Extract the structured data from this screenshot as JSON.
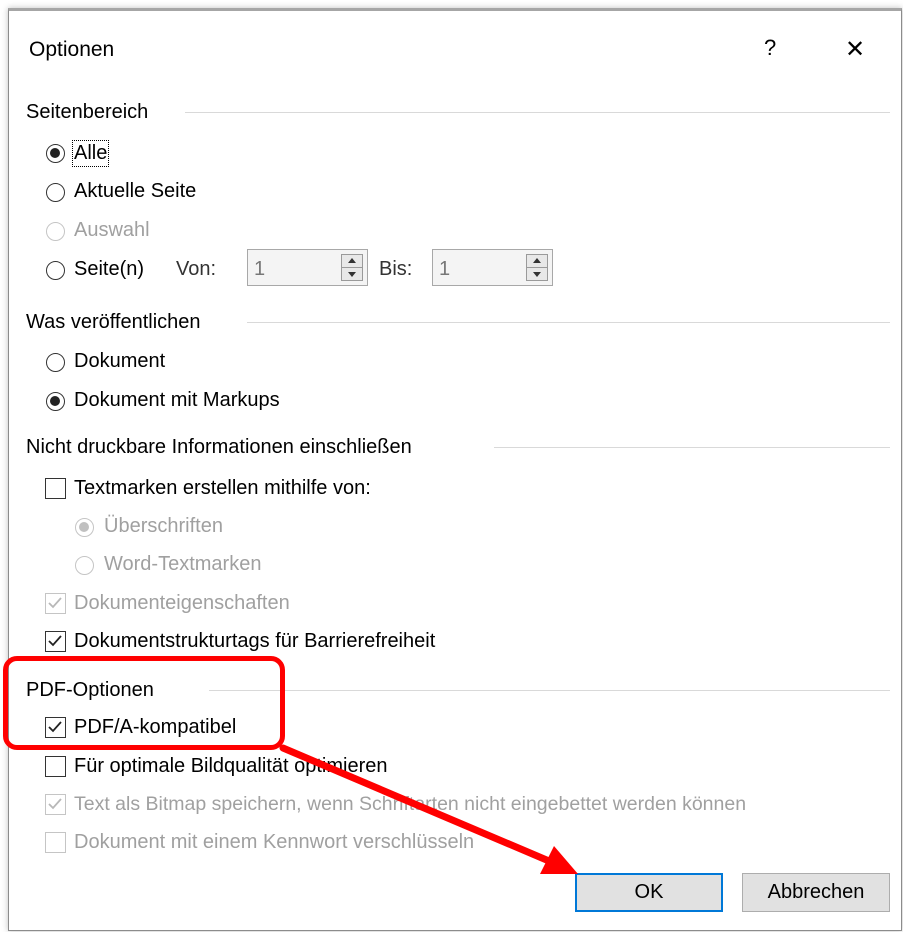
{
  "dialog": {
    "title": "Optionen",
    "help_label": "?",
    "close_label": "✕"
  },
  "seitenbereich": {
    "heading": "Seitenbereich",
    "alle": "Alle",
    "aktuelle_seite": "Aktuelle Seite",
    "auswahl": "Auswahl",
    "seiten": "Seite(n)",
    "von_label": "Von:",
    "von_value": "1",
    "bis_label": "Bis:",
    "bis_value": "1"
  },
  "veroeffentlichen": {
    "heading": "Was veröffentlichen",
    "dokument": "Dokument",
    "dokument_markups": "Dokument mit Markups"
  },
  "nicht_druckbar": {
    "heading": "Nicht druckbare Informationen einschließen",
    "textmarken": "Textmarken erstellen mithilfe von:",
    "ueberschriften": "Überschriften",
    "word_textmarken": "Word-Textmarken",
    "dokumenteigenschaften": "Dokumenteigenschaften",
    "strukturtags": "Dokumentstrukturtags für Barrierefreiheit"
  },
  "pdf_optionen": {
    "heading": "PDF-Optionen",
    "pdfa": "PDF/A-kompatibel",
    "bildqualitaet": "Für optimale Bildqualität optimieren",
    "bitmap": "Text als Bitmap speichern, wenn Schriftarten nicht eingebettet werden können",
    "kennwort": "Dokument mit einem Kennwort verschlüsseln"
  },
  "buttons": {
    "ok": "OK",
    "abbrechen": "Abbrechen"
  },
  "colors": {
    "highlight": "#ff0000",
    "default_button_border": "#0078d7",
    "disabled_text": "#a0a0a0"
  },
  "state": {
    "seitenbereich_selected": "Alle",
    "veroeffentlichen_selected": "Dokument mit Markups",
    "textmarken_checked": false,
    "ueberschriften_selected": true,
    "dokumenteigenschaften_checked": true,
    "strukturtags_checked": true,
    "pdfa_checked": true,
    "bildqualitaet_checked": false,
    "bitmap_checked": true,
    "kennwort_checked": false
  }
}
